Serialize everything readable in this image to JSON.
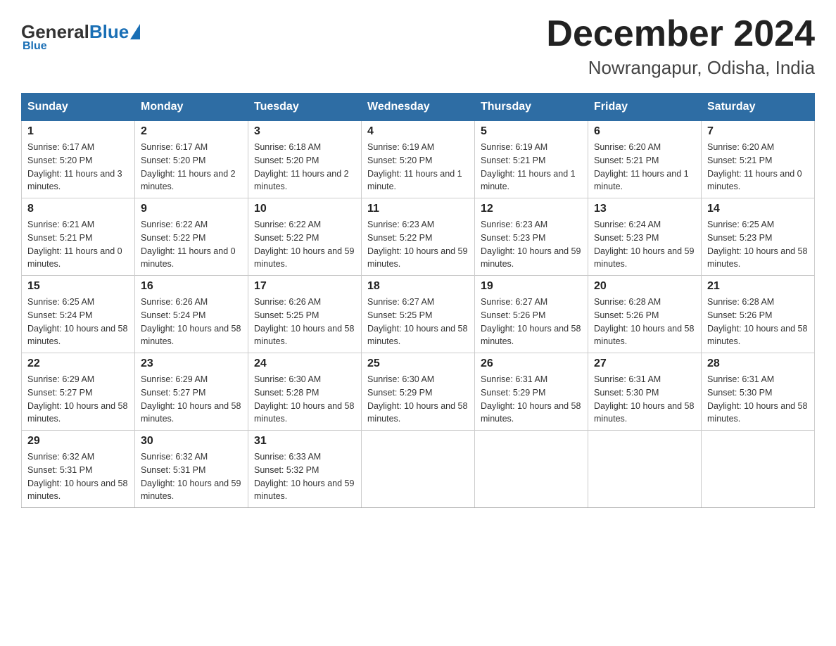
{
  "logo": {
    "general": "General",
    "blue": "Blue",
    "subtitle": "Blue"
  },
  "title": "December 2024",
  "location": "Nowrangapur, Odisha, India",
  "weekdays": [
    "Sunday",
    "Monday",
    "Tuesday",
    "Wednesday",
    "Thursday",
    "Friday",
    "Saturday"
  ],
  "weeks": [
    [
      {
        "day": "1",
        "sunrise": "6:17 AM",
        "sunset": "5:20 PM",
        "daylight": "11 hours and 3 minutes."
      },
      {
        "day": "2",
        "sunrise": "6:17 AM",
        "sunset": "5:20 PM",
        "daylight": "11 hours and 2 minutes."
      },
      {
        "day": "3",
        "sunrise": "6:18 AM",
        "sunset": "5:20 PM",
        "daylight": "11 hours and 2 minutes."
      },
      {
        "day": "4",
        "sunrise": "6:19 AM",
        "sunset": "5:20 PM",
        "daylight": "11 hours and 1 minute."
      },
      {
        "day": "5",
        "sunrise": "6:19 AM",
        "sunset": "5:21 PM",
        "daylight": "11 hours and 1 minute."
      },
      {
        "day": "6",
        "sunrise": "6:20 AM",
        "sunset": "5:21 PM",
        "daylight": "11 hours and 1 minute."
      },
      {
        "day": "7",
        "sunrise": "6:20 AM",
        "sunset": "5:21 PM",
        "daylight": "11 hours and 0 minutes."
      }
    ],
    [
      {
        "day": "8",
        "sunrise": "6:21 AM",
        "sunset": "5:21 PM",
        "daylight": "11 hours and 0 minutes."
      },
      {
        "day": "9",
        "sunrise": "6:22 AM",
        "sunset": "5:22 PM",
        "daylight": "11 hours and 0 minutes."
      },
      {
        "day": "10",
        "sunrise": "6:22 AM",
        "sunset": "5:22 PM",
        "daylight": "10 hours and 59 minutes."
      },
      {
        "day": "11",
        "sunrise": "6:23 AM",
        "sunset": "5:22 PM",
        "daylight": "10 hours and 59 minutes."
      },
      {
        "day": "12",
        "sunrise": "6:23 AM",
        "sunset": "5:23 PM",
        "daylight": "10 hours and 59 minutes."
      },
      {
        "day": "13",
        "sunrise": "6:24 AM",
        "sunset": "5:23 PM",
        "daylight": "10 hours and 59 minutes."
      },
      {
        "day": "14",
        "sunrise": "6:25 AM",
        "sunset": "5:23 PM",
        "daylight": "10 hours and 58 minutes."
      }
    ],
    [
      {
        "day": "15",
        "sunrise": "6:25 AM",
        "sunset": "5:24 PM",
        "daylight": "10 hours and 58 minutes."
      },
      {
        "day": "16",
        "sunrise": "6:26 AM",
        "sunset": "5:24 PM",
        "daylight": "10 hours and 58 minutes."
      },
      {
        "day": "17",
        "sunrise": "6:26 AM",
        "sunset": "5:25 PM",
        "daylight": "10 hours and 58 minutes."
      },
      {
        "day": "18",
        "sunrise": "6:27 AM",
        "sunset": "5:25 PM",
        "daylight": "10 hours and 58 minutes."
      },
      {
        "day": "19",
        "sunrise": "6:27 AM",
        "sunset": "5:26 PM",
        "daylight": "10 hours and 58 minutes."
      },
      {
        "day": "20",
        "sunrise": "6:28 AM",
        "sunset": "5:26 PM",
        "daylight": "10 hours and 58 minutes."
      },
      {
        "day": "21",
        "sunrise": "6:28 AM",
        "sunset": "5:26 PM",
        "daylight": "10 hours and 58 minutes."
      }
    ],
    [
      {
        "day": "22",
        "sunrise": "6:29 AM",
        "sunset": "5:27 PM",
        "daylight": "10 hours and 58 minutes."
      },
      {
        "day": "23",
        "sunrise": "6:29 AM",
        "sunset": "5:27 PM",
        "daylight": "10 hours and 58 minutes."
      },
      {
        "day": "24",
        "sunrise": "6:30 AM",
        "sunset": "5:28 PM",
        "daylight": "10 hours and 58 minutes."
      },
      {
        "day": "25",
        "sunrise": "6:30 AM",
        "sunset": "5:29 PM",
        "daylight": "10 hours and 58 minutes."
      },
      {
        "day": "26",
        "sunrise": "6:31 AM",
        "sunset": "5:29 PM",
        "daylight": "10 hours and 58 minutes."
      },
      {
        "day": "27",
        "sunrise": "6:31 AM",
        "sunset": "5:30 PM",
        "daylight": "10 hours and 58 minutes."
      },
      {
        "day": "28",
        "sunrise": "6:31 AM",
        "sunset": "5:30 PM",
        "daylight": "10 hours and 58 minutes."
      }
    ],
    [
      {
        "day": "29",
        "sunrise": "6:32 AM",
        "sunset": "5:31 PM",
        "daylight": "10 hours and 58 minutes."
      },
      {
        "day": "30",
        "sunrise": "6:32 AM",
        "sunset": "5:31 PM",
        "daylight": "10 hours and 59 minutes."
      },
      {
        "day": "31",
        "sunrise": "6:33 AM",
        "sunset": "5:32 PM",
        "daylight": "10 hours and 59 minutes."
      },
      null,
      null,
      null,
      null
    ]
  ],
  "labels": {
    "sunrise": "Sunrise:",
    "sunset": "Sunset:",
    "daylight": "Daylight:"
  }
}
